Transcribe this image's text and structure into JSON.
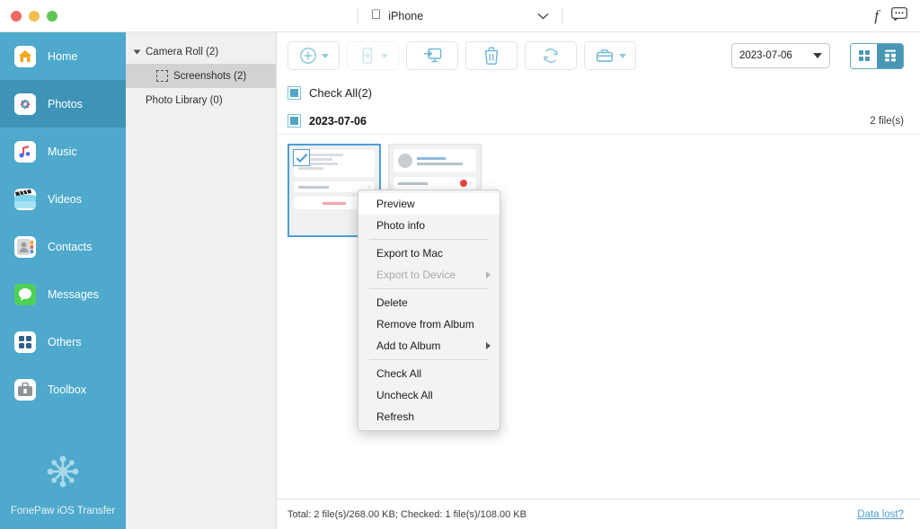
{
  "window": {
    "traffic_lights": [
      "close",
      "minimize",
      "maximize"
    ],
    "device_name": "iPhone",
    "right_icons": [
      "facebook-icon",
      "feedback-icon"
    ]
  },
  "nav": {
    "items": [
      {
        "label": "Home",
        "icon": "home-icon"
      },
      {
        "label": "Photos",
        "icon": "photos-icon",
        "active": true
      },
      {
        "label": "Music",
        "icon": "music-icon"
      },
      {
        "label": "Videos",
        "icon": "videos-icon"
      },
      {
        "label": "Contacts",
        "icon": "contacts-icon"
      },
      {
        "label": "Messages",
        "icon": "messages-icon"
      },
      {
        "label": "Others",
        "icon": "others-icon"
      },
      {
        "label": "Toolbox",
        "icon": "toolbox-icon"
      }
    ],
    "brand": "FonePaw iOS Transfer",
    "brand_icon": "snowflake-icon"
  },
  "tree": {
    "items": [
      {
        "label": "Camera Roll (2)",
        "level": 0,
        "expanded": true,
        "selected": false
      },
      {
        "label": "Screenshots (2)",
        "level": 1,
        "selected": true
      },
      {
        "label": "Photo Library (0)",
        "level": 0,
        "selected": false
      }
    ]
  },
  "toolbar": {
    "buttons": [
      {
        "name": "add-button",
        "icon": "plus-circle-icon",
        "has_caret": true,
        "disabled": false
      },
      {
        "name": "export-to-device-button",
        "icon": "phone-export-icon",
        "has_caret": true,
        "disabled": true
      },
      {
        "name": "export-to-mac-button",
        "icon": "monitor-export-icon",
        "has_caret": false,
        "disabled": false
      },
      {
        "name": "delete-button",
        "icon": "trash-icon",
        "has_caret": false,
        "disabled": false
      },
      {
        "name": "refresh-button",
        "icon": "refresh-icon",
        "has_caret": false,
        "disabled": false
      },
      {
        "name": "album-button",
        "icon": "briefcase-icon",
        "has_caret": true,
        "disabled": false
      }
    ],
    "date_filter": "2023-07-06",
    "view_modes": [
      {
        "name": "grid-view-button",
        "icon": "grid-view-icon",
        "active": false
      },
      {
        "name": "detail-view-button",
        "icon": "detail-view-icon",
        "active": true
      }
    ]
  },
  "content": {
    "check_all_label": "Check All(2)",
    "group_date": "2023-07-06",
    "group_count": "2 file(s)",
    "thumbnails": [
      {
        "name": "photo-thumbnail-1",
        "selected": true,
        "checked": true
      },
      {
        "name": "photo-thumbnail-2",
        "selected": false,
        "checked": false
      }
    ]
  },
  "context_menu": {
    "items": [
      {
        "label": "Preview",
        "disabled": false,
        "submenu": false,
        "highlighted": true
      },
      {
        "label": "Photo info",
        "disabled": false,
        "submenu": false
      },
      {
        "separator": true
      },
      {
        "label": "Export to Mac",
        "disabled": false,
        "submenu": false
      },
      {
        "label": "Export to Device",
        "disabled": true,
        "submenu": true
      },
      {
        "separator": true
      },
      {
        "label": "Delete",
        "disabled": false,
        "submenu": false
      },
      {
        "label": "Remove from Album",
        "disabled": false,
        "submenu": false
      },
      {
        "label": "Add to Album",
        "disabled": false,
        "submenu": true
      },
      {
        "separator": true
      },
      {
        "label": "Check All",
        "disabled": false,
        "submenu": false
      },
      {
        "label": "Uncheck All",
        "disabled": false,
        "submenu": false
      },
      {
        "label": "Refresh",
        "disabled": false,
        "submenu": false
      }
    ]
  },
  "status": {
    "summary": "Total: 2 file(s)/268.00 KB; Checked: 1 file(s)/108.00 KB",
    "link": "Data lost?"
  },
  "colors": {
    "sidebar": "#4ea9cc",
    "sidebar_active": "#3e93b7",
    "accent": "#4e9ed4",
    "toggle_active": "#4a96b5",
    "link": "#4e9ed4"
  }
}
